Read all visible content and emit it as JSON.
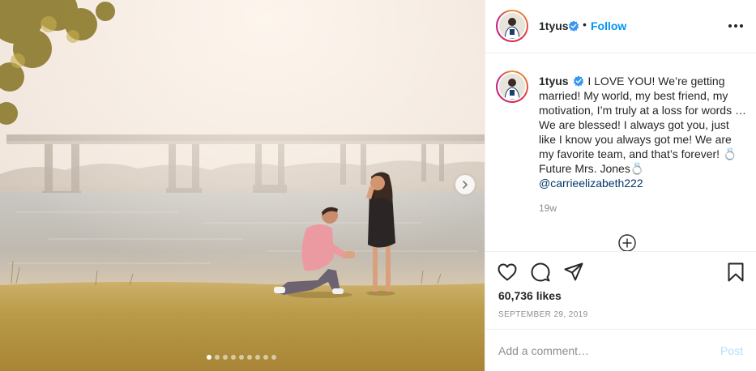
{
  "post": {
    "username": "1tyus",
    "separator": "•",
    "follow_label": "Follow",
    "caption": {
      "username": "1tyus",
      "text": "I LOVE YOU! We’re getting married! My world, my best friend, my motivation, I’m truly at a loss for words … We are blessed! I always got you, just like I know you always got me! We are my favorite team, and that’s forever! 💍 Future Mrs. Jones💍",
      "mention": "@carrieelizabeth222"
    },
    "age": "19w",
    "likes": "60,736 likes",
    "date": "SEPTEMBER 29, 2019",
    "comment": {
      "placeholder": "Add a comment…",
      "value": "",
      "post_label": "Post"
    },
    "carousel": {
      "slide_count": 9,
      "active_index": 0
    }
  },
  "icons": {
    "verified": "verified-badge-icon",
    "more": "more-options-icon",
    "like": "heart-icon",
    "comment": "comment-bubble-icon",
    "share": "paper-plane-icon",
    "save": "bookmark-icon",
    "load_more": "plus-circle-icon",
    "next": "chevron-right-icon"
  },
  "colors": {
    "accent": "#0095f6",
    "verified": "#3897f0",
    "text": "#262626",
    "muted": "#8e8e8e",
    "post_disabled": "#b2dffc",
    "mention": "#00376b"
  }
}
